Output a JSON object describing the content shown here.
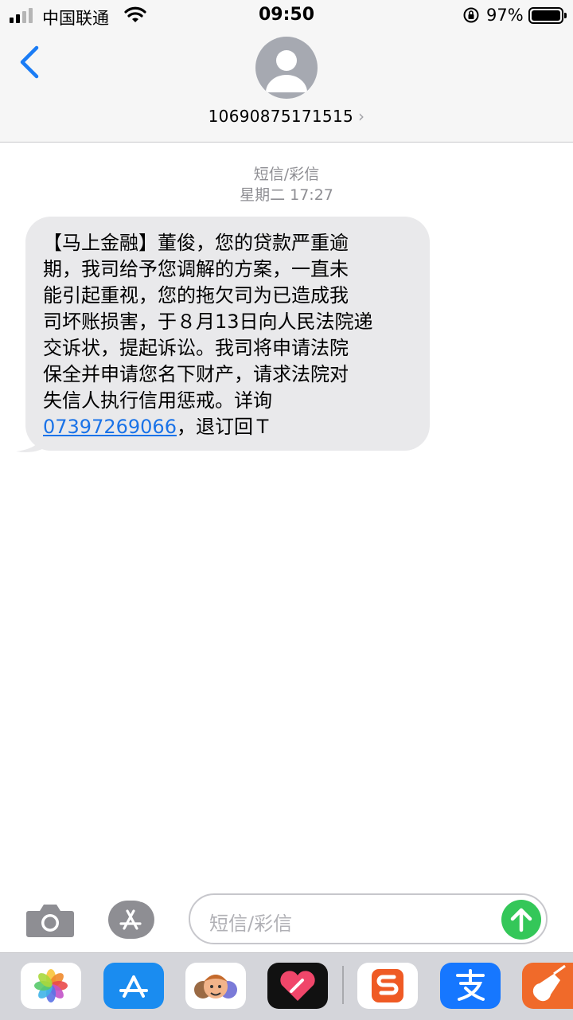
{
  "status_bar": {
    "carrier": "中国联通",
    "time": "09:50",
    "battery_percent": "97%"
  },
  "header": {
    "sender_number": "10690875171515",
    "chevron": "›"
  },
  "conversation": {
    "message_type": "短信/彩信",
    "timestamp": "星期二 17:27",
    "message_lines": [
      "【马上金融】董俊，您的贷款严重逾",
      "期，我司给予您调解的方案，一直未",
      "能引起重视，您的拖欠司为已造成我",
      "司坏账损害，于８月13日向人民法院递",
      "交诉状，提起诉讼。我司将申请法院",
      "保全并申请您名下财产，请求法院对",
      "失信人执行信用惩戒。详询"
    ],
    "phone_link": "07397269066",
    "message_suffix": "，退订回Ｔ"
  },
  "input": {
    "placeholder": "短信/彩信"
  },
  "drawer": {
    "apps": [
      "photos-app-icon",
      "app-store-app-icon",
      "memoji-app-icon",
      "digital-touch-app-icon",
      "sogou-app-icon",
      "alipay-app-icon",
      "garageband-app-icon"
    ]
  },
  "colors": {
    "link": "#1a73e8",
    "send_button": "#34c759",
    "back_chevron": "#1a7cf5",
    "bubble": "#e9e9eb"
  }
}
